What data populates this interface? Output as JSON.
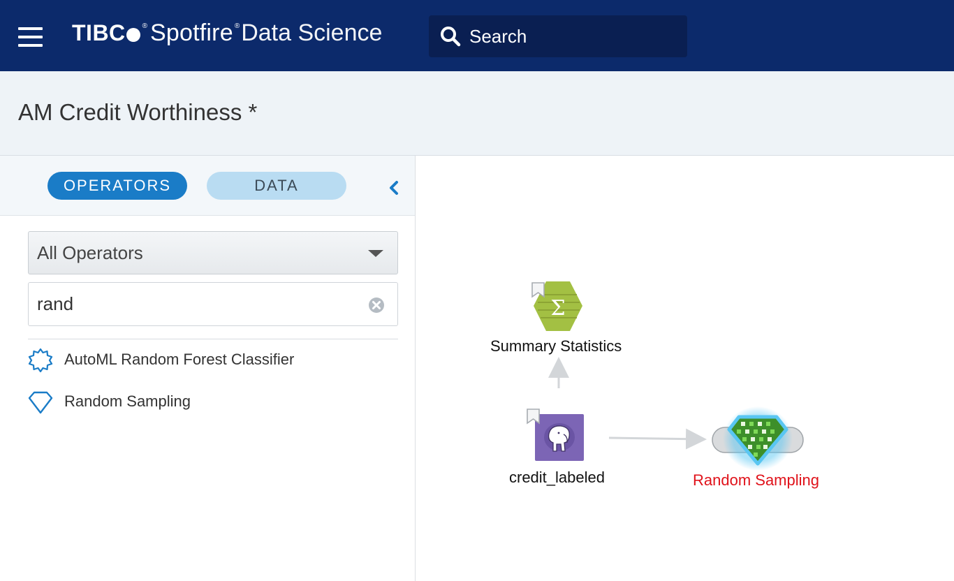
{
  "header": {
    "brand": {
      "tibco": "TIBC",
      "spotfire": "Spotfire",
      "product": "Data Science",
      "registered_mark": "®"
    },
    "search": {
      "label": "Search"
    }
  },
  "workflow": {
    "title": "AM Credit Worthiness *"
  },
  "sidebar": {
    "tabs": [
      {
        "label": "OPERATORS",
        "active": true
      },
      {
        "label": "DATA",
        "active": false
      }
    ],
    "operator_filter": {
      "selected": "All Operators"
    },
    "search_input": {
      "value": "rand"
    },
    "operators": [
      {
        "label": "AutoML Random Forest Classifier",
        "icon": "automl-star-icon"
      },
      {
        "label": "Random Sampling",
        "icon": "diamond-icon"
      }
    ]
  },
  "canvas": {
    "nodes": [
      {
        "label": "Summary Statistics",
        "icon": "sigma-icon",
        "bookmarked": true,
        "status": "normal"
      },
      {
        "label": "credit_labeled",
        "icon": "postgres-elephant-icon",
        "bookmarked": true,
        "status": "normal"
      },
      {
        "label": "Random Sampling",
        "icon": "diamond-grid-icon",
        "bookmarked": false,
        "status": "error"
      }
    ]
  },
  "colors": {
    "header_bg": "#0c2a6b",
    "search_bg": "#0a1f52",
    "title_band_bg": "#eef3f7",
    "tab_active": "#1a7cc7",
    "tab_inactive": "#b9dcf2",
    "accent_blue": "#1a7cc7",
    "error_red": "#e0121a",
    "summary_node": "#a3c043",
    "source_node": "#7c65b5",
    "sampling_node": "#5fbd3c"
  }
}
